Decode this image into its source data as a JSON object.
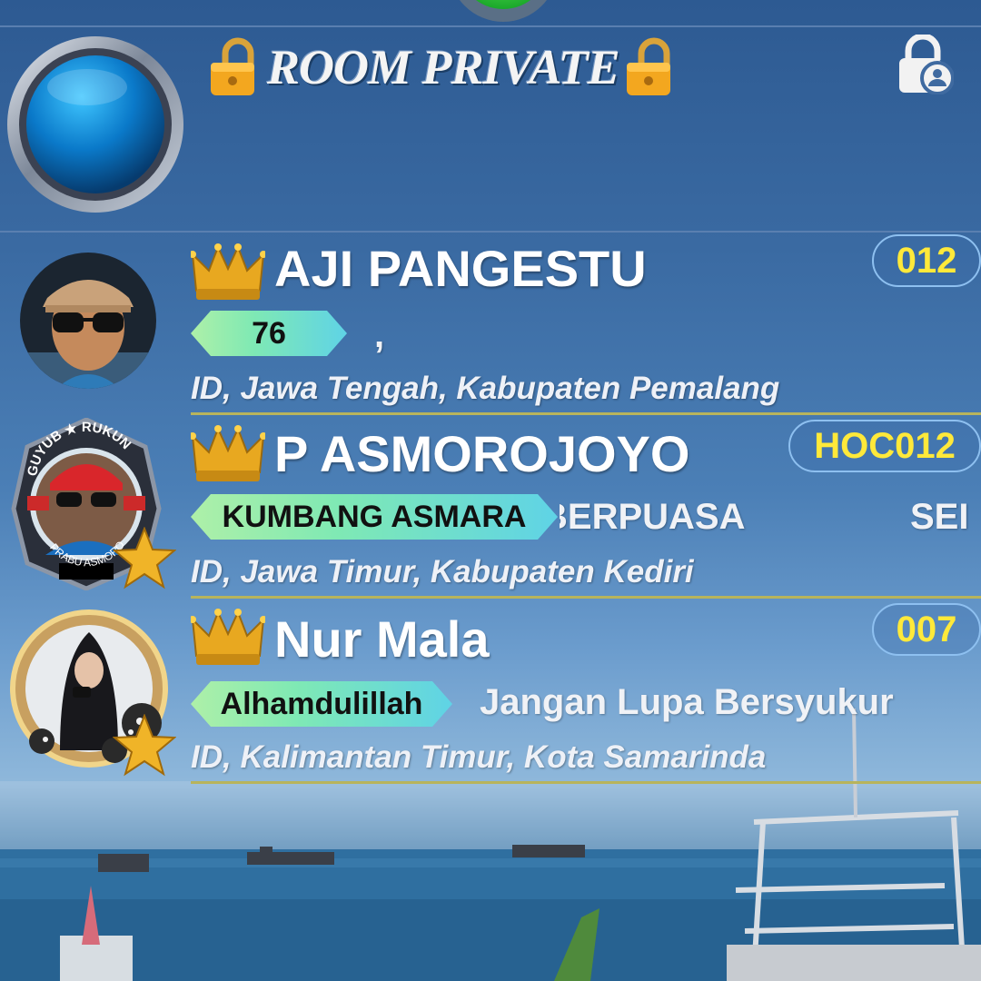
{
  "header": {
    "room_title": "ROOM PRIVATE",
    "lock_user_icon": "lock-user-icon"
  },
  "users": [
    {
      "name": "AJI PANGESTU",
      "room_id": "012",
      "tag": "76",
      "status": ",",
      "location": "ID, Jawa Tengah, Kabupaten Pemalang",
      "badge_icon": "crown-icon"
    },
    {
      "name": "P ASMOROJOYO",
      "room_id": "HOC012",
      "tag": "KUMBANG ASMARA",
      "status_part1": "BERPUASA",
      "status_part2": "SEI",
      "location": "ID, Jawa Timur, Kabupaten Kediri",
      "frame_text_top": "GUYUB ★ RUKUN",
      "frame_text_bottom": "PRABU ASMORO",
      "badge_icon": "crown-icon"
    },
    {
      "name": "Nur Mala",
      "room_id": "007",
      "tag": "Alhamdulillah",
      "status": "Jangan Lupa Bersyukur",
      "location": "ID, Kalimantan Timur, Kota Samarinda",
      "badge_icon": "crown-icon"
    }
  ],
  "colors": {
    "id_text": "#ffe93a",
    "separator": "#b8b45c",
    "tag_start": "#aef0a8",
    "tag_end": "#5fd3e6"
  }
}
